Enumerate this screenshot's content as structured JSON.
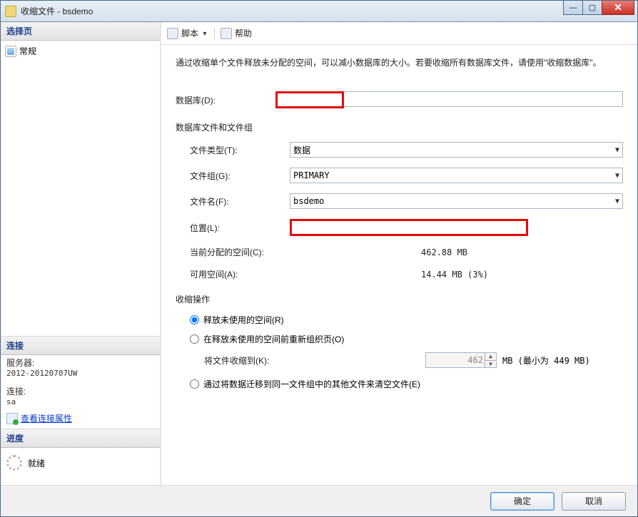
{
  "title": "收缩文件 - bsdemo",
  "winbtns": {
    "min": "—",
    "max": "▢",
    "close": "✕"
  },
  "left": {
    "select_page": "选择页",
    "general": "常规",
    "connection": "连接",
    "server_label": "服务器:",
    "server_value": "2012-20120707UW",
    "conn_label": "连接:",
    "conn_value": "sa",
    "view_props": "查看连接属性",
    "progress": "进度",
    "ready": "就绪"
  },
  "toolbar": {
    "script": "脚本",
    "help": "帮助"
  },
  "main": {
    "desc": "通过收缩单个文件释放未分配的空间，可以减小数据库的大小。若要收缩所有数据库文件，请使用\"收缩数据库\"。",
    "db_label": "数据库(D):",
    "section_files": "数据库文件和文件组",
    "filetype_label": "文件类型(T):",
    "filetype_value": "数据",
    "filegroup_label": "文件组(G):",
    "filegroup_value": "PRIMARY",
    "filename_label": "文件名(F):",
    "filename_value": "bsdemo",
    "location_label": "位置(L):",
    "allocated_label": "当前分配的空间(C):",
    "allocated_value": "462.88 MB",
    "available_label": "可用空间(A):",
    "available_value": "14.44 MB (3%)",
    "shrink_action": "收缩操作",
    "radio1": "释放未使用的空间(R)",
    "radio2": "在释放未使用的空间前重新组织页(O)",
    "shrink_to_label": "将文件收缩到(K):",
    "shrink_to_value": "462",
    "shrink_hint": "MB (最小为 449 MB)",
    "radio3": "通过将数据迁移到同一文件组中的其他文件来清空文件(E)"
  },
  "buttons": {
    "ok": "确定",
    "cancel": "取消"
  }
}
